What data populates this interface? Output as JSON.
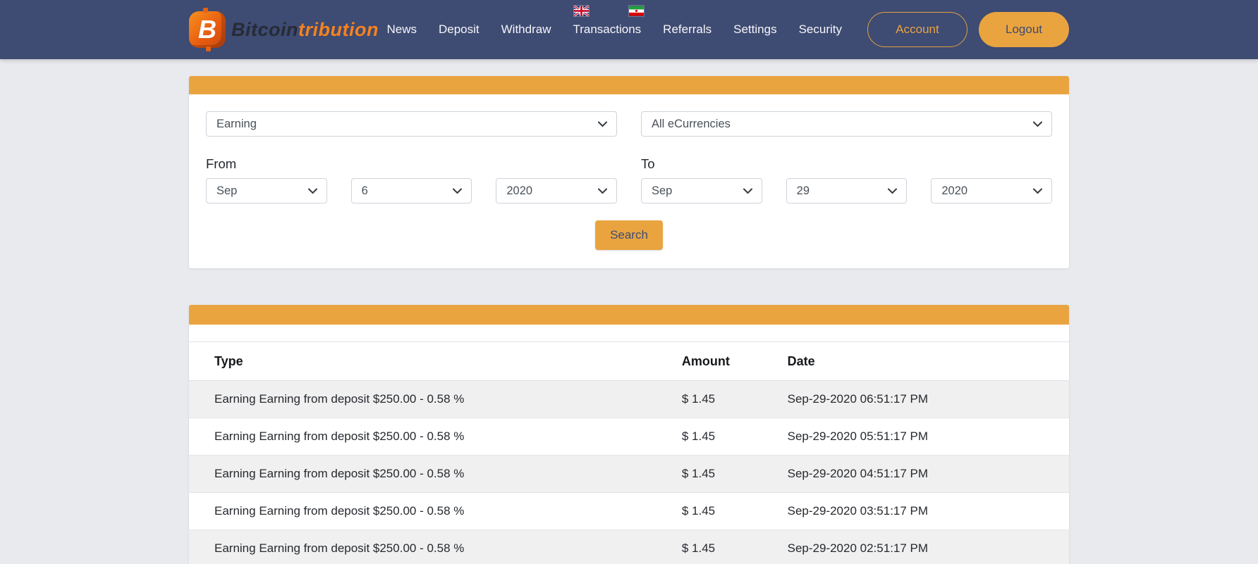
{
  "brand": {
    "icon_letter": "B",
    "word_primary": "Bitcoin",
    "word_accent": "tribution"
  },
  "nav": {
    "links": [
      {
        "label": "News"
      },
      {
        "label": "Deposit"
      },
      {
        "label": "Withdraw"
      },
      {
        "label": "Transactions"
      },
      {
        "label": "Referrals"
      },
      {
        "label": "Settings"
      },
      {
        "label": "Security"
      }
    ],
    "language_flags": [
      {
        "name": "english-flag"
      },
      {
        "name": "persian-flag"
      }
    ],
    "account_label": "Account",
    "logout_label": "Logout"
  },
  "filters": {
    "type_value": "Earning",
    "currency_value": "All eCurrencies",
    "from_label": "From",
    "from_month": "Sep",
    "from_day": "6",
    "from_year": "2020",
    "to_label": "To",
    "to_month": "Sep",
    "to_day": "29",
    "to_year": "2020",
    "search_label": "Search"
  },
  "table": {
    "headers": {
      "type": "Type",
      "amount": "Amount",
      "date": "Date"
    },
    "rows": [
      {
        "type": "Earning Earning from deposit $250.00 - 0.58 %",
        "amount": "$ 1.45",
        "date": "Sep-29-2020 06:51:17 PM"
      },
      {
        "type": "Earning Earning from deposit $250.00 - 0.58 %",
        "amount": "$ 1.45",
        "date": "Sep-29-2020 05:51:17 PM"
      },
      {
        "type": "Earning Earning from deposit $250.00 - 0.58 %",
        "amount": "$ 1.45",
        "date": "Sep-29-2020 04:51:17 PM"
      },
      {
        "type": "Earning Earning from deposit $250.00 - 0.58 %",
        "amount": "$ 1.45",
        "date": "Sep-29-2020 03:51:17 PM"
      },
      {
        "type": "Earning Earning from deposit $250.00 - 0.58 %",
        "amount": "$ 1.45",
        "date": "Sep-29-2020 02:51:17 PM"
      }
    ]
  },
  "colors": {
    "accent": "#E9A440",
    "nav_bg": "#3E4B72",
    "page_bg": "#E9EAEE",
    "logo_orange": "#F5821F",
    "row_stripe": "#F0F0F0"
  }
}
